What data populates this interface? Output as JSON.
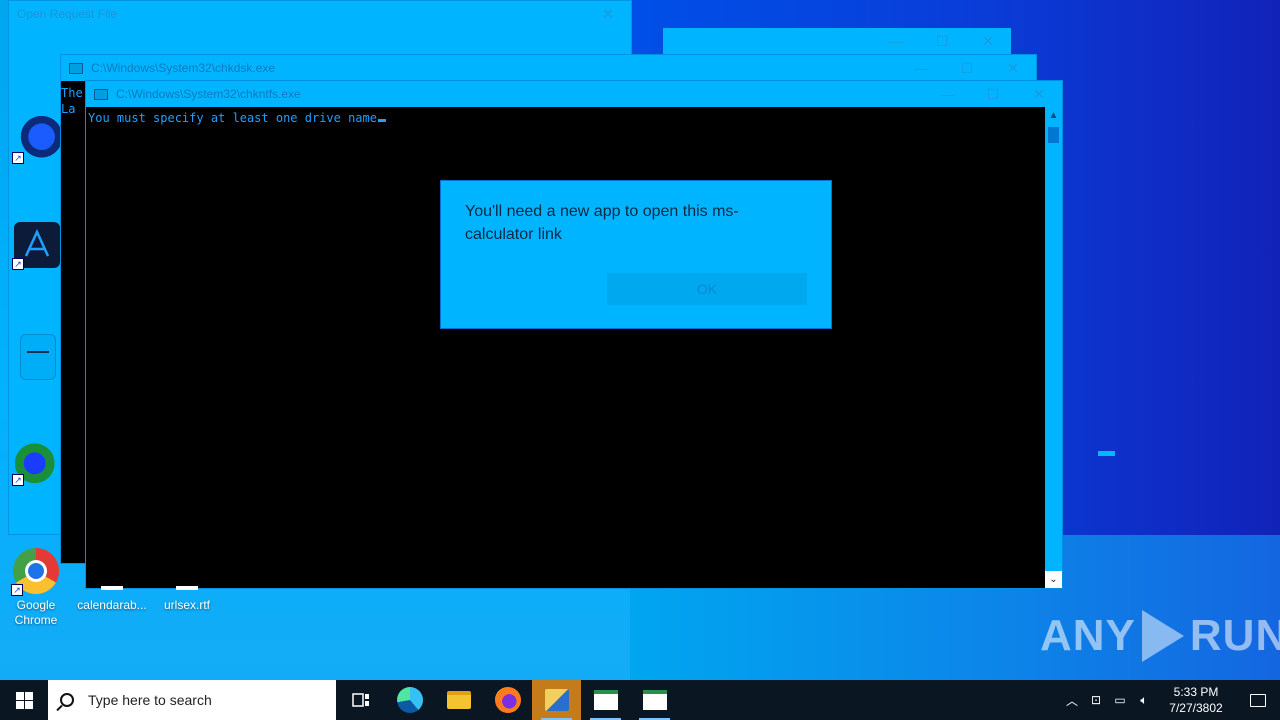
{
  "windows": {
    "open_request": {
      "title": "Open Request File"
    },
    "chkdsk": {
      "title": "C:\\Windows\\System32\\chkdsk.exe",
      "console_lines": [
        "The",
        " La"
      ]
    },
    "chkntfs": {
      "title": "C:\\Windows\\System32\\chkntfs.exe",
      "console_text": "You must specify at least one drive name"
    }
  },
  "dialog": {
    "message": "You'll need a new app to open this ms-calculator link",
    "ok_label": "OK"
  },
  "desktop_icons": [
    {
      "label": "Google Chrome"
    },
    {
      "label": "calendarab..."
    },
    {
      "label": "urlsex.rtf"
    }
  ],
  "watermark": {
    "left": "ANY",
    "right": "RUN"
  },
  "taskbar": {
    "search_placeholder": "Type here to search",
    "apps": [
      "task-view",
      "edge",
      "file-explorer",
      "firefox",
      "utility",
      "window-a",
      "window-b"
    ]
  },
  "clock": {
    "time": "5:33 PM",
    "date": "7/27/3802"
  },
  "controls": {
    "minimize": "—",
    "maximize": "☐",
    "close": "✕"
  }
}
